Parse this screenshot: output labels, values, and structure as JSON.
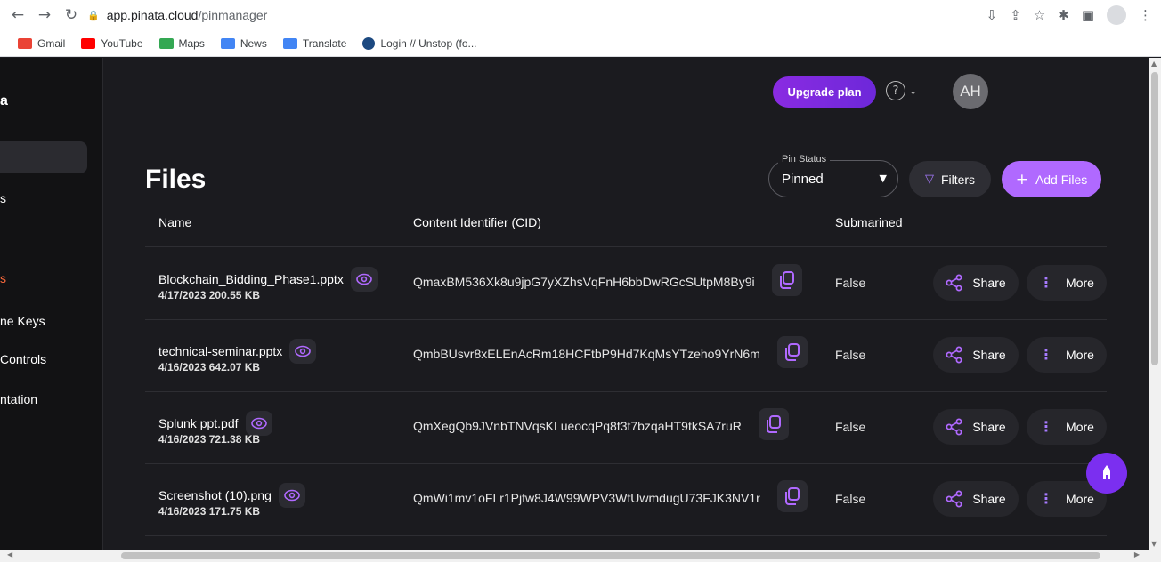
{
  "browser": {
    "url_host": "app.pinata.cloud",
    "url_path": "/pinmanager",
    "bookmarks": [
      {
        "label": "Gmail",
        "icon": "gmail-icon",
        "color": "#ea4335"
      },
      {
        "label": "YouTube",
        "icon": "youtube-icon",
        "color": "#ff0000"
      },
      {
        "label": "Maps",
        "icon": "maps-icon",
        "color": "#34a853"
      },
      {
        "label": "News",
        "icon": "news-icon",
        "color": "#4285f4"
      },
      {
        "label": "Translate",
        "icon": "translate-icon",
        "color": "#4285f4"
      },
      {
        "label": "Login // Unstop (fo...",
        "icon": "unstop-icon",
        "color": "#1c4980"
      }
    ]
  },
  "sidebar": {
    "logo_fragment": "a",
    "items": [
      {
        "label": "s"
      },
      {
        "label": "s",
        "accent": true
      },
      {
        "label": "ne Keys"
      },
      {
        "label": "Controls"
      },
      {
        "label": "ntation"
      }
    ]
  },
  "header": {
    "upgrade_label": "Upgrade plan",
    "help_icon": "help-circle-icon",
    "avatar_initials": "AH"
  },
  "main": {
    "title": "Files",
    "pin_status": {
      "label": "Pin Status",
      "value": "Pinned"
    },
    "filters_label": "Filters",
    "add_files_label": "Add Files",
    "columns": [
      "Name",
      "Content Identifier (CID)",
      "Submarined"
    ],
    "rows": [
      {
        "name": "Blockchain_Bidding_Phase1.pptx",
        "meta": "4/17/2023 200.55 KB",
        "cid": "QmaxBM536Xk8u9jpG7yXZhsVqFnH6bbDwRGcSUtpM8By9i",
        "submarined": "False"
      },
      {
        "name": "technical-seminar.pptx",
        "meta": "4/16/2023 642.07 KB",
        "cid": "QmbBUsvr8xELEnAcRm18HCFtbP9Hd7KqMsYTzeho9YrN6m",
        "submarined": "False"
      },
      {
        "name": "Splunk ppt.pdf",
        "meta": "4/16/2023 721.38 KB",
        "cid": "QmXegQb9JVnbTNVqsKLueocqPq8f3t7bzqaHT9tkSA7ruR",
        "submarined": "False"
      },
      {
        "name": "Screenshot (10).png",
        "meta": "4/16/2023 171.75 KB",
        "cid": "QmWi1mv1oFLr1Pjfw8J4W99WPV3WfUwmdugU73FJK3NV1r",
        "submarined": "False"
      }
    ],
    "share_label": "Share",
    "more_label": "More"
  },
  "colors": {
    "accent_purple": "#b069ff",
    "upgrade_gradient_start": "#8a2be2",
    "background": "#1b1b1f",
    "sidebar_bg": "#121214"
  }
}
